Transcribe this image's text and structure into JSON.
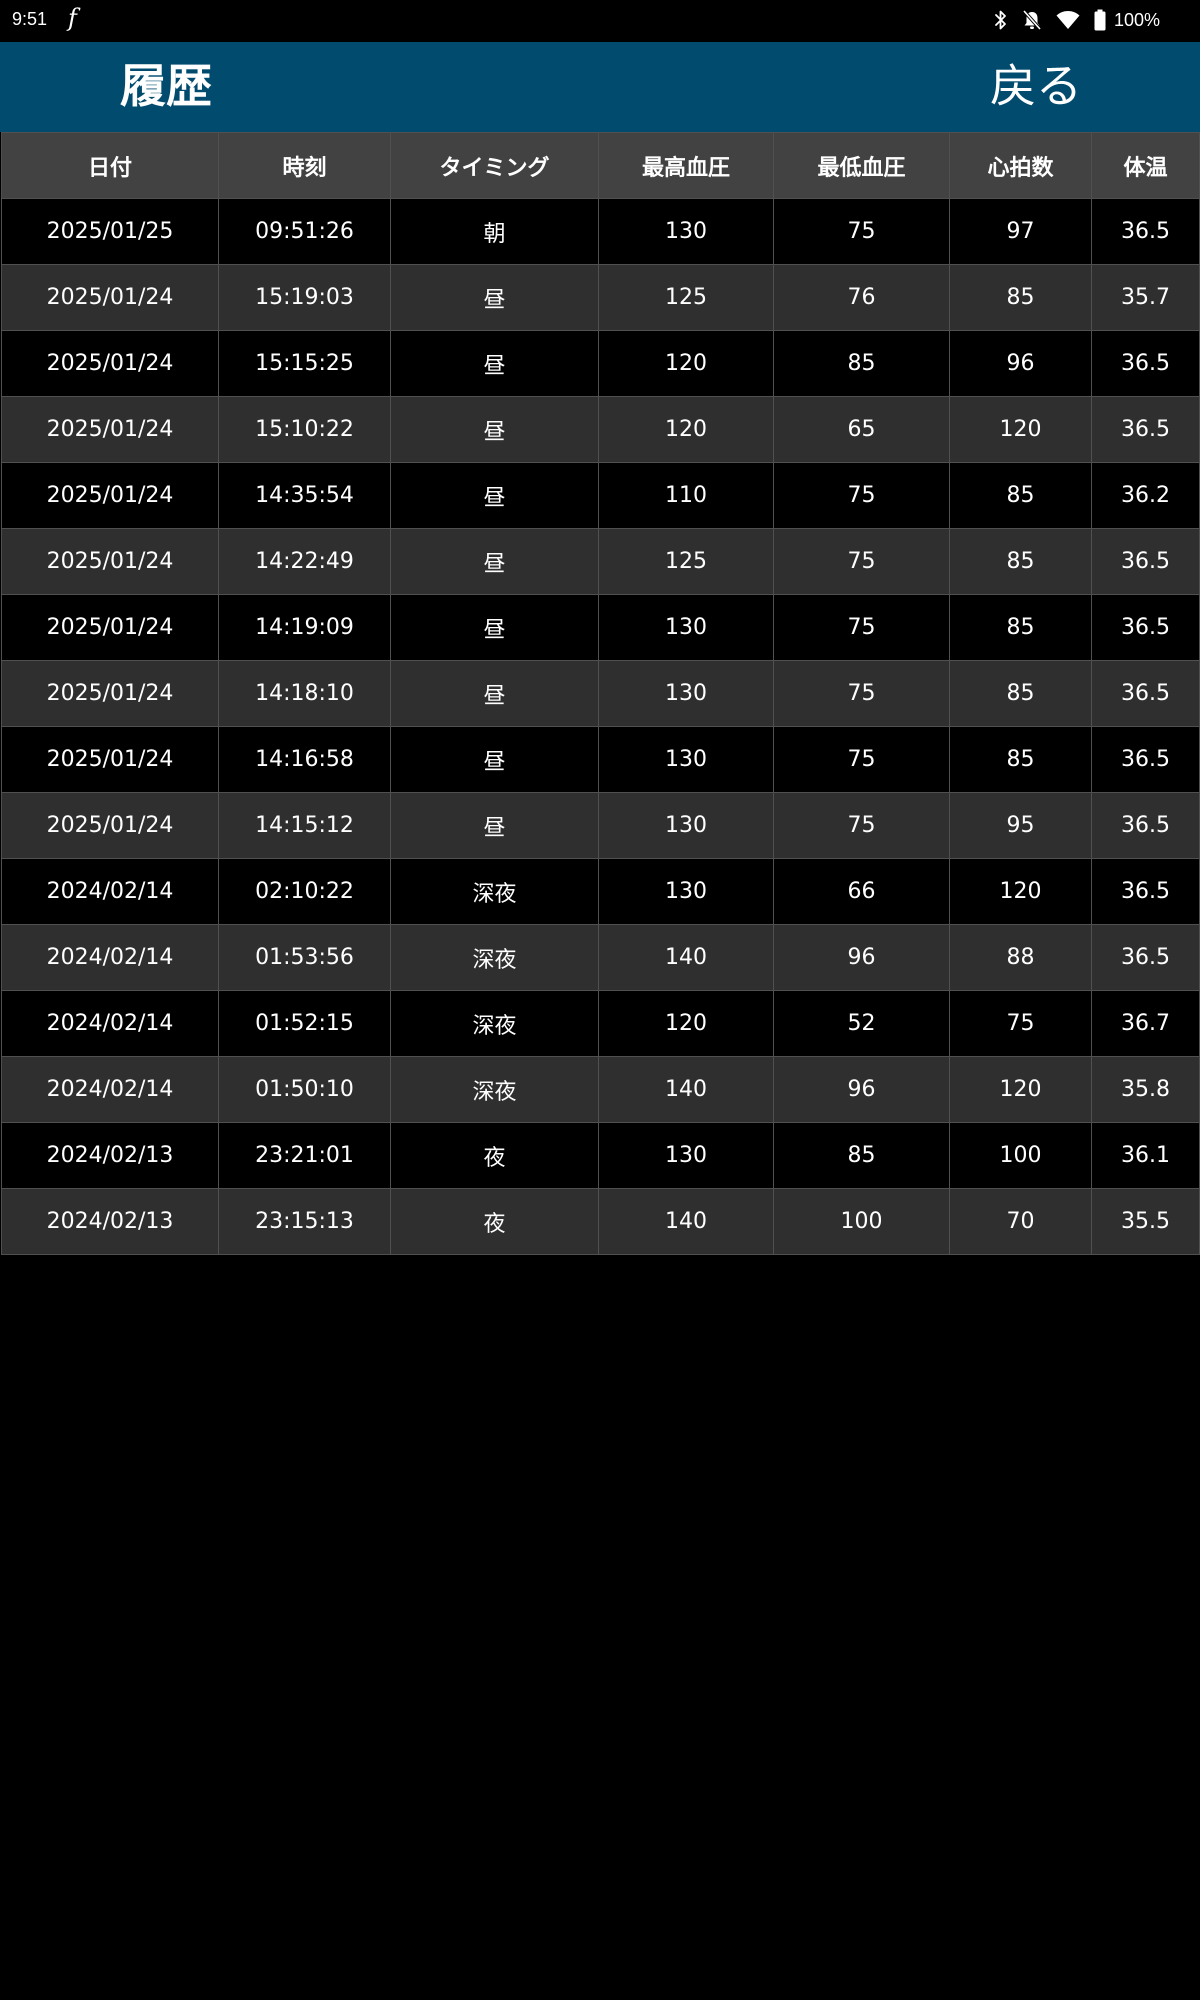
{
  "status_bar": {
    "time": "9:51",
    "app_icon": "f",
    "battery": "100%",
    "icons": [
      "bluetooth-icon",
      "bell-off-icon",
      "wifi-icon",
      "battery-icon"
    ]
  },
  "header": {
    "title": "履歴",
    "back_label": "戻る",
    "background_color": "#014b6f"
  },
  "table": {
    "columns": [
      "日付",
      "時刻",
      "タイミング",
      "最高血圧",
      "最低血圧",
      "心拍数",
      "体温"
    ],
    "rows": [
      [
        "2025/01/25",
        "09:51:26",
        "朝",
        "130",
        "75",
        "97",
        "36.5"
      ],
      [
        "2025/01/24",
        "15:19:03",
        "昼",
        "125",
        "76",
        "85",
        "35.7"
      ],
      [
        "2025/01/24",
        "15:15:25",
        "昼",
        "120",
        "85",
        "96",
        "36.5"
      ],
      [
        "2025/01/24",
        "15:10:22",
        "昼",
        "120",
        "65",
        "120",
        "36.5"
      ],
      [
        "2025/01/24",
        "14:35:54",
        "昼",
        "110",
        "75",
        "85",
        "36.2"
      ],
      [
        "2025/01/24",
        "14:22:49",
        "昼",
        "125",
        "75",
        "85",
        "36.5"
      ],
      [
        "2025/01/24",
        "14:19:09",
        "昼",
        "130",
        "75",
        "85",
        "36.5"
      ],
      [
        "2025/01/24",
        "14:18:10",
        "昼",
        "130",
        "75",
        "85",
        "36.5"
      ],
      [
        "2025/01/24",
        "14:16:58",
        "昼",
        "130",
        "75",
        "85",
        "36.5"
      ],
      [
        "2025/01/24",
        "14:15:12",
        "昼",
        "130",
        "75",
        "95",
        "36.5"
      ],
      [
        "2024/02/14",
        "02:10:22",
        "深夜",
        "130",
        "66",
        "120",
        "36.5"
      ],
      [
        "2024/02/14",
        "01:53:56",
        "深夜",
        "140",
        "96",
        "88",
        "36.5"
      ],
      [
        "2024/02/14",
        "01:52:15",
        "深夜",
        "120",
        "52",
        "75",
        "36.7"
      ],
      [
        "2024/02/14",
        "01:50:10",
        "深夜",
        "140",
        "96",
        "120",
        "35.8"
      ],
      [
        "2024/02/13",
        "23:21:01",
        "夜",
        "130",
        "85",
        "100",
        "36.1"
      ],
      [
        "2024/02/13",
        "23:15:13",
        "夜",
        "140",
        "100",
        "70",
        "35.5"
      ]
    ]
  }
}
